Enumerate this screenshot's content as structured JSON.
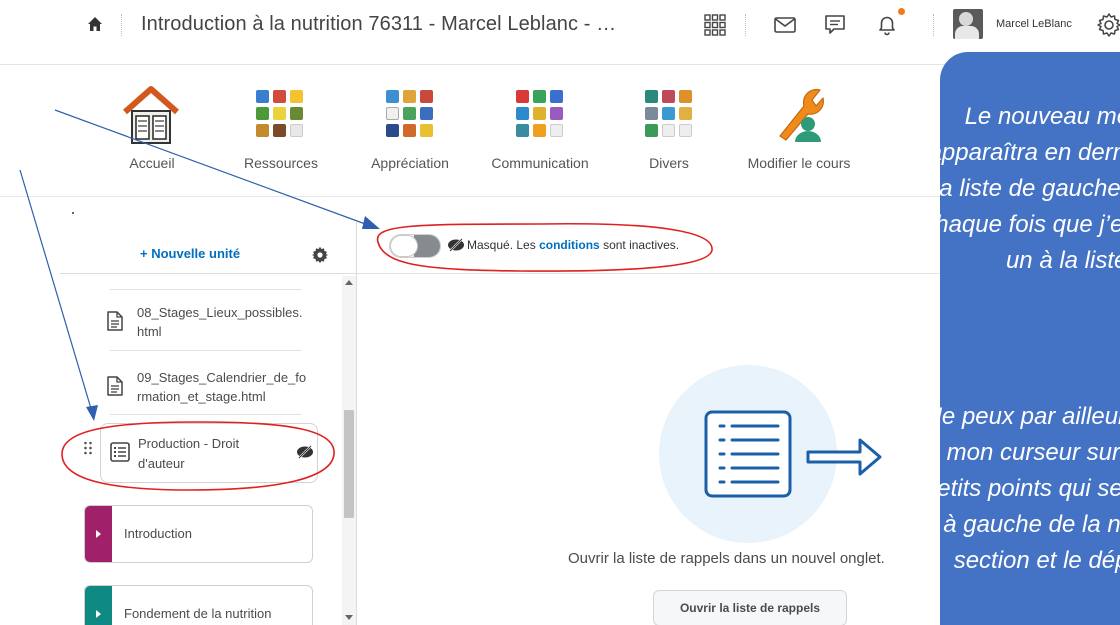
{
  "topbar": {
    "course_title": "Introduction à la nutrition 76311 - Marcel Leblanc - …",
    "user_name": "Marcel LeBlanc",
    "icons": [
      "home-icon",
      "app-grid-icon",
      "mail-icon",
      "chat-icon",
      "bell-icon",
      "gear-icon"
    ],
    "notification_color": "#ee7a1e"
  },
  "nav": {
    "items": [
      {
        "label": "Accueil",
        "icon": "house-book-icon"
      },
      {
        "label": "Ressources",
        "icon": "resources-grid-icon"
      },
      {
        "label": "Appréciation",
        "icon": "assessment-grid-icon"
      },
      {
        "label": "Communication",
        "icon": "communication-grid-icon"
      },
      {
        "label": "Divers",
        "icon": "misc-grid-icon"
      },
      {
        "label": "Modifier le cours",
        "icon": "wrench-user-icon"
      }
    ]
  },
  "panel": {
    "new_unit": "+ Nouvelle unité",
    "files": [
      "08_Stages_Lieux_possibles.html",
      "09_Stages_Calendrier_de_formation_et_stage.html"
    ],
    "production": "Production - Droit d'auteur",
    "units": [
      {
        "label": "Introduction",
        "color": "#a0206a"
      },
      {
        "label": "Fondement de la nutrition",
        "color": "#0f8a83"
      }
    ]
  },
  "main": {
    "visibility_prefix": "Masqué. Les",
    "visibility_link": "conditions",
    "visibility_suffix": "sont inactives.",
    "reminder_text": "Ouvrir la liste de rappels dans un nouvel onglet.",
    "reminder_button": "Ouvrir la liste de rappels"
  },
  "callout": {
    "paragraph1": "Le nouveau module apparaîtra en dernier dans la liste de gauche et ce, à chaque fois que j’en rajoute un à la liste.",
    "paragraph2": "Je peux par ailleurs placer mon curseur sur les six petits points qui se trouvent à gauche de la nouvelle section et le déplacer.",
    "background": "#4472c4"
  },
  "annotations": {
    "color": "#e0201f",
    "arrow_color": "#2f5fae"
  }
}
